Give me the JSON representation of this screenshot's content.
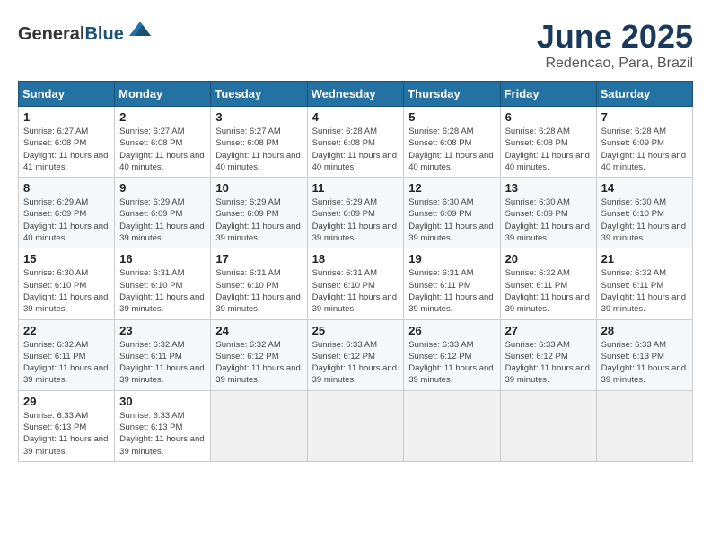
{
  "header": {
    "logo_general": "General",
    "logo_blue": "Blue",
    "title": "June 2025",
    "location": "Redencao, Para, Brazil"
  },
  "calendar": {
    "days_of_week": [
      "Sunday",
      "Monday",
      "Tuesday",
      "Wednesday",
      "Thursday",
      "Friday",
      "Saturday"
    ],
    "weeks": [
      [
        null,
        {
          "day": "2",
          "sunrise": "6:27 AM",
          "sunset": "6:08 PM",
          "daylight": "11 hours and 40 minutes."
        },
        {
          "day": "3",
          "sunrise": "6:27 AM",
          "sunset": "6:08 PM",
          "daylight": "11 hours and 40 minutes."
        },
        {
          "day": "4",
          "sunrise": "6:28 AM",
          "sunset": "6:08 PM",
          "daylight": "11 hours and 40 minutes."
        },
        {
          "day": "5",
          "sunrise": "6:28 AM",
          "sunset": "6:08 PM",
          "daylight": "11 hours and 40 minutes."
        },
        {
          "day": "6",
          "sunrise": "6:28 AM",
          "sunset": "6:08 PM",
          "daylight": "11 hours and 40 minutes."
        },
        {
          "day": "7",
          "sunrise": "6:28 AM",
          "sunset": "6:09 PM",
          "daylight": "11 hours and 40 minutes."
        }
      ],
      [
        {
          "day": "1",
          "sunrise": "6:27 AM",
          "sunset": "6:08 PM",
          "daylight": "11 hours and 41 minutes."
        },
        {
          "day": "9",
          "sunrise": "6:29 AM",
          "sunset": "6:09 PM",
          "daylight": "11 hours and 39 minutes."
        },
        {
          "day": "10",
          "sunrise": "6:29 AM",
          "sunset": "6:09 PM",
          "daylight": "11 hours and 39 minutes."
        },
        {
          "day": "11",
          "sunrise": "6:29 AM",
          "sunset": "6:09 PM",
          "daylight": "11 hours and 39 minutes."
        },
        {
          "day": "12",
          "sunrise": "6:30 AM",
          "sunset": "6:09 PM",
          "daylight": "11 hours and 39 minutes."
        },
        {
          "day": "13",
          "sunrise": "6:30 AM",
          "sunset": "6:09 PM",
          "daylight": "11 hours and 39 minutes."
        },
        {
          "day": "14",
          "sunrise": "6:30 AM",
          "sunset": "6:10 PM",
          "daylight": "11 hours and 39 minutes."
        }
      ],
      [
        {
          "day": "8",
          "sunrise": "6:29 AM",
          "sunset": "6:09 PM",
          "daylight": "11 hours and 40 minutes."
        },
        {
          "day": "16",
          "sunrise": "6:31 AM",
          "sunset": "6:10 PM",
          "daylight": "11 hours and 39 minutes."
        },
        {
          "day": "17",
          "sunrise": "6:31 AM",
          "sunset": "6:10 PM",
          "daylight": "11 hours and 39 minutes."
        },
        {
          "day": "18",
          "sunrise": "6:31 AM",
          "sunset": "6:10 PM",
          "daylight": "11 hours and 39 minutes."
        },
        {
          "day": "19",
          "sunrise": "6:31 AM",
          "sunset": "6:11 PM",
          "daylight": "11 hours and 39 minutes."
        },
        {
          "day": "20",
          "sunrise": "6:32 AM",
          "sunset": "6:11 PM",
          "daylight": "11 hours and 39 minutes."
        },
        {
          "day": "21",
          "sunrise": "6:32 AM",
          "sunset": "6:11 PM",
          "daylight": "11 hours and 39 minutes."
        }
      ],
      [
        {
          "day": "15",
          "sunrise": "6:30 AM",
          "sunset": "6:10 PM",
          "daylight": "11 hours and 39 minutes."
        },
        {
          "day": "23",
          "sunrise": "6:32 AM",
          "sunset": "6:11 PM",
          "daylight": "11 hours and 39 minutes."
        },
        {
          "day": "24",
          "sunrise": "6:32 AM",
          "sunset": "6:12 PM",
          "daylight": "11 hours and 39 minutes."
        },
        {
          "day": "25",
          "sunrise": "6:33 AM",
          "sunset": "6:12 PM",
          "daylight": "11 hours and 39 minutes."
        },
        {
          "day": "26",
          "sunrise": "6:33 AM",
          "sunset": "6:12 PM",
          "daylight": "11 hours and 39 minutes."
        },
        {
          "day": "27",
          "sunrise": "6:33 AM",
          "sunset": "6:12 PM",
          "daylight": "11 hours and 39 minutes."
        },
        {
          "day": "28",
          "sunrise": "6:33 AM",
          "sunset": "6:13 PM",
          "daylight": "11 hours and 39 minutes."
        }
      ],
      [
        {
          "day": "22",
          "sunrise": "6:32 AM",
          "sunset": "6:11 PM",
          "daylight": "11 hours and 39 minutes."
        },
        {
          "day": "30",
          "sunrise": "6:33 AM",
          "sunset": "6:13 PM",
          "daylight": "11 hours and 39 minutes."
        },
        null,
        null,
        null,
        null,
        null
      ],
      [
        {
          "day": "29",
          "sunrise": "6:33 AM",
          "sunset": "6:13 PM",
          "daylight": "11 hours and 39 minutes."
        },
        null,
        null,
        null,
        null,
        null,
        null
      ]
    ]
  }
}
